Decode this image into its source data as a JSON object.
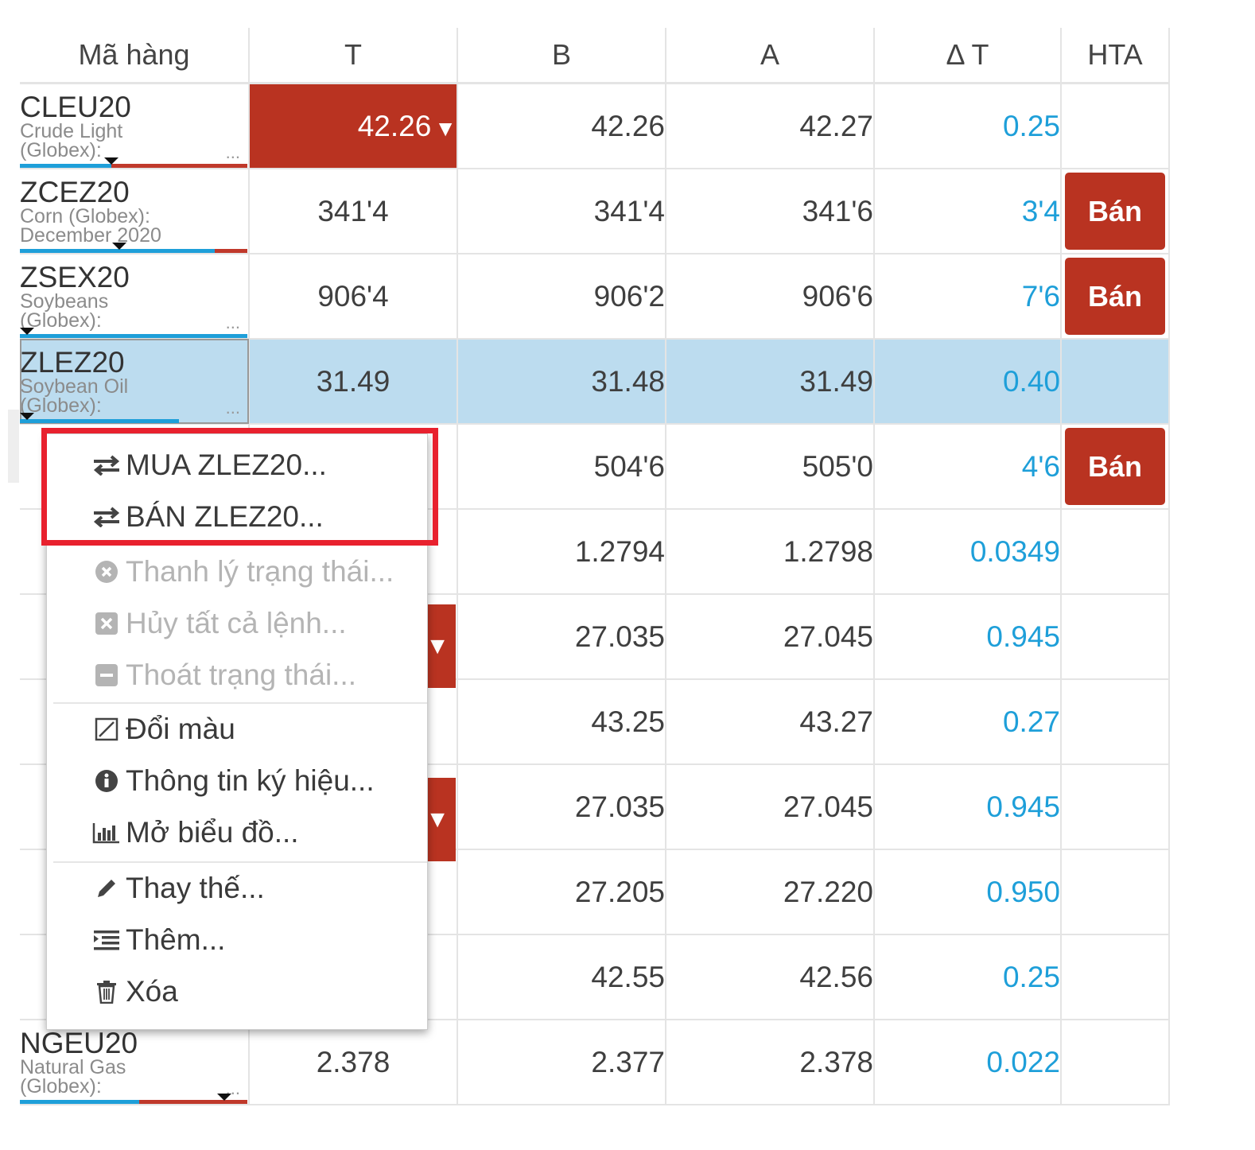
{
  "columns": [
    "Mã hàng",
    "T",
    "B",
    "A",
    "Δ T",
    "HTA"
  ],
  "rows": [
    {
      "code": "CLEU20",
      "desc1": "Crude Light",
      "desc2": "(Globex):",
      "t": "42.26",
      "t_arrow": "▼",
      "b": "42.26",
      "a": "42.27",
      "delta": "0.25",
      "hta": ""
    },
    {
      "code": "ZCEZ20",
      "desc1": "Corn (Globex):",
      "desc2": "December 2020",
      "t": "341'4",
      "b": "341'4",
      "a": "341'6",
      "delta": "3'4",
      "hta": "Bán"
    },
    {
      "code": "ZSEX20",
      "desc1": "Soybeans",
      "desc2": "(Globex):",
      "t": "906'4",
      "b": "906'2",
      "a": "906'6",
      "delta": "7'6",
      "hta": "Bán"
    },
    {
      "code": "ZLEZ20",
      "desc1": "Soybean Oil",
      "desc2": "(Globex):",
      "t": "31.49",
      "b": "31.48",
      "a": "31.49",
      "delta": "0.40",
      "hta": ""
    },
    {
      "code": "",
      "desc1": "",
      "desc2": "",
      "t": "",
      "b": "504'6",
      "a": "505'0",
      "delta": "4'6",
      "hta": "Bán"
    },
    {
      "code": "",
      "desc1": "",
      "desc2": "",
      "t": "",
      "b": "1.2794",
      "a": "1.2798",
      "delta": "0.0349",
      "hta": ""
    },
    {
      "code": "",
      "desc1": "",
      "desc2": "",
      "t": "",
      "t_arrow": "▼",
      "b": "27.035",
      "a": "27.045",
      "delta": "0.945",
      "hta": ""
    },
    {
      "code": "",
      "desc1": "",
      "desc2": "",
      "t": "",
      "b": "43.25",
      "a": "43.27",
      "delta": "0.27",
      "hta": ""
    },
    {
      "code": "",
      "desc1": "",
      "desc2": "",
      "t": "",
      "t_arrow": "▼",
      "b": "27.035",
      "a": "27.045",
      "delta": "0.945",
      "hta": ""
    },
    {
      "code": "",
      "desc1": "",
      "desc2": "",
      "t": "",
      "b": "27.205",
      "a": "27.220",
      "delta": "0.950",
      "hta": ""
    },
    {
      "code": "",
      "desc1": "",
      "desc2": "",
      "t": "",
      "b": "42.55",
      "a": "42.56",
      "delta": "0.25",
      "hta": ""
    },
    {
      "code": "NGEU20",
      "desc1": "Natural Gas",
      "desc2": "(Globex):",
      "t": "2.378",
      "b": "2.377",
      "a": "2.378",
      "delta": "0.022",
      "hta": ""
    }
  ],
  "row_dots": "...",
  "context_menu": {
    "buy": "MUA ZLEZ20...",
    "sell": "BÁN ZLEZ20...",
    "liquidate": "Thanh lý trạng thái...",
    "cancel_all": "Hủy tất cả lệnh...",
    "exit_position": "Thoát trạng thái...",
    "change_color": "Đổi màu",
    "symbol_info": "Thông tin ký hiệu...",
    "open_chart": "Mở biểu đồ...",
    "replace": "Thay thế...",
    "add": "Thêm...",
    "delete": "Xóa"
  },
  "colors": {
    "sell_red": "#b93321",
    "delta_blue": "#1e9fd9",
    "selected_row": "#bcdcef",
    "highlight_box": "#e8212e"
  }
}
